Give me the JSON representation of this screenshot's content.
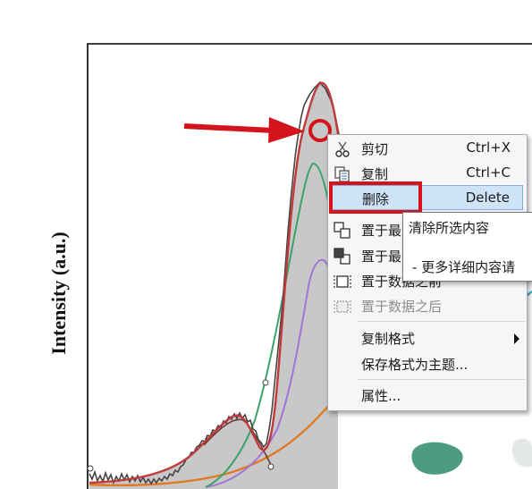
{
  "chart": {
    "ylabel": "Intensity (a.u.)"
  },
  "context_menu": {
    "items": [
      {
        "label": "剪切",
        "shortcut": "Ctrl+X",
        "icon": "scissors-icon",
        "enabled": true
      },
      {
        "label": "复制",
        "shortcut": "Ctrl+C",
        "icon": "copy-icon",
        "enabled": true
      },
      {
        "label": "删除",
        "shortcut": "Delete",
        "icon": "",
        "enabled": true,
        "highlighted": true
      },
      {
        "label": "置于最",
        "shortcut": "",
        "icon": "bring-to-front-icon",
        "enabled": true
      },
      {
        "label": "置于最",
        "shortcut": "",
        "icon": "send-to-back-icon",
        "enabled": true
      },
      {
        "label": "置于数据之前",
        "shortcut": "",
        "icon": "in-front-of-data-icon",
        "enabled": true
      },
      {
        "label": "置于数据之后",
        "shortcut": "",
        "icon": "behind-data-icon",
        "enabled": false
      },
      {
        "label": "复制格式",
        "shortcut": "",
        "icon": "",
        "enabled": true,
        "submenu": true
      },
      {
        "label": "保存格式为主题...",
        "shortcut": "",
        "icon": "",
        "enabled": true
      },
      {
        "label": "属性...",
        "shortcut": "",
        "icon": "",
        "enabled": true
      }
    ]
  },
  "tooltip": {
    "line1": "清除所选内容",
    "line2": "- 更多详细内容请"
  },
  "colors": {
    "annotation_red": "#d4141d",
    "envelope": "#c0393b",
    "fill": "#c8c8c8",
    "green_peak": "#3aa36b",
    "purple_peak": "#a274d6",
    "orange_baseline": "#e07a22",
    "noisy_data": "#444444"
  }
}
